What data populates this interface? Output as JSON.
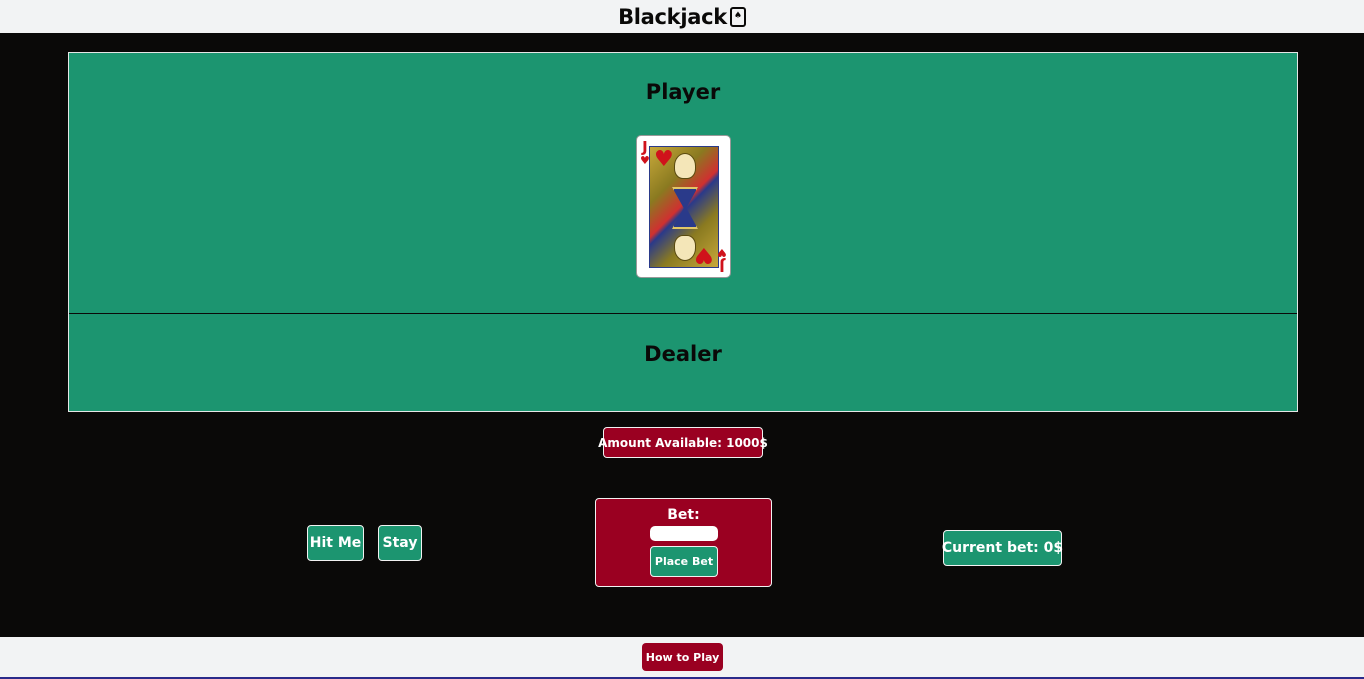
{
  "header": {
    "title": "Blackjack",
    "logo_icon": "spade-card-icon",
    "logo_glyph": "♠"
  },
  "table": {
    "player_title": "Player",
    "dealer_title": "Dealer",
    "player_cards": [
      {
        "rank": "J",
        "suit": "♥",
        "suit_name": "hearts"
      }
    ],
    "dealer_cards": []
  },
  "amount_available": "Amount Available: 1000$",
  "controls": {
    "hit_label": "Hit Me",
    "stay_label": "Stay",
    "bet_label": "Bet:",
    "bet_input_value": "",
    "place_bet_label": "Place Bet",
    "current_bet": "Current bet: 0$"
  },
  "footer": {
    "how_to_play_label": "How to Play"
  },
  "colors": {
    "table_green": "#1c9570",
    "button_red": "#9a0021",
    "background": "#0a0908",
    "header_bg": "#f2f3f4"
  }
}
